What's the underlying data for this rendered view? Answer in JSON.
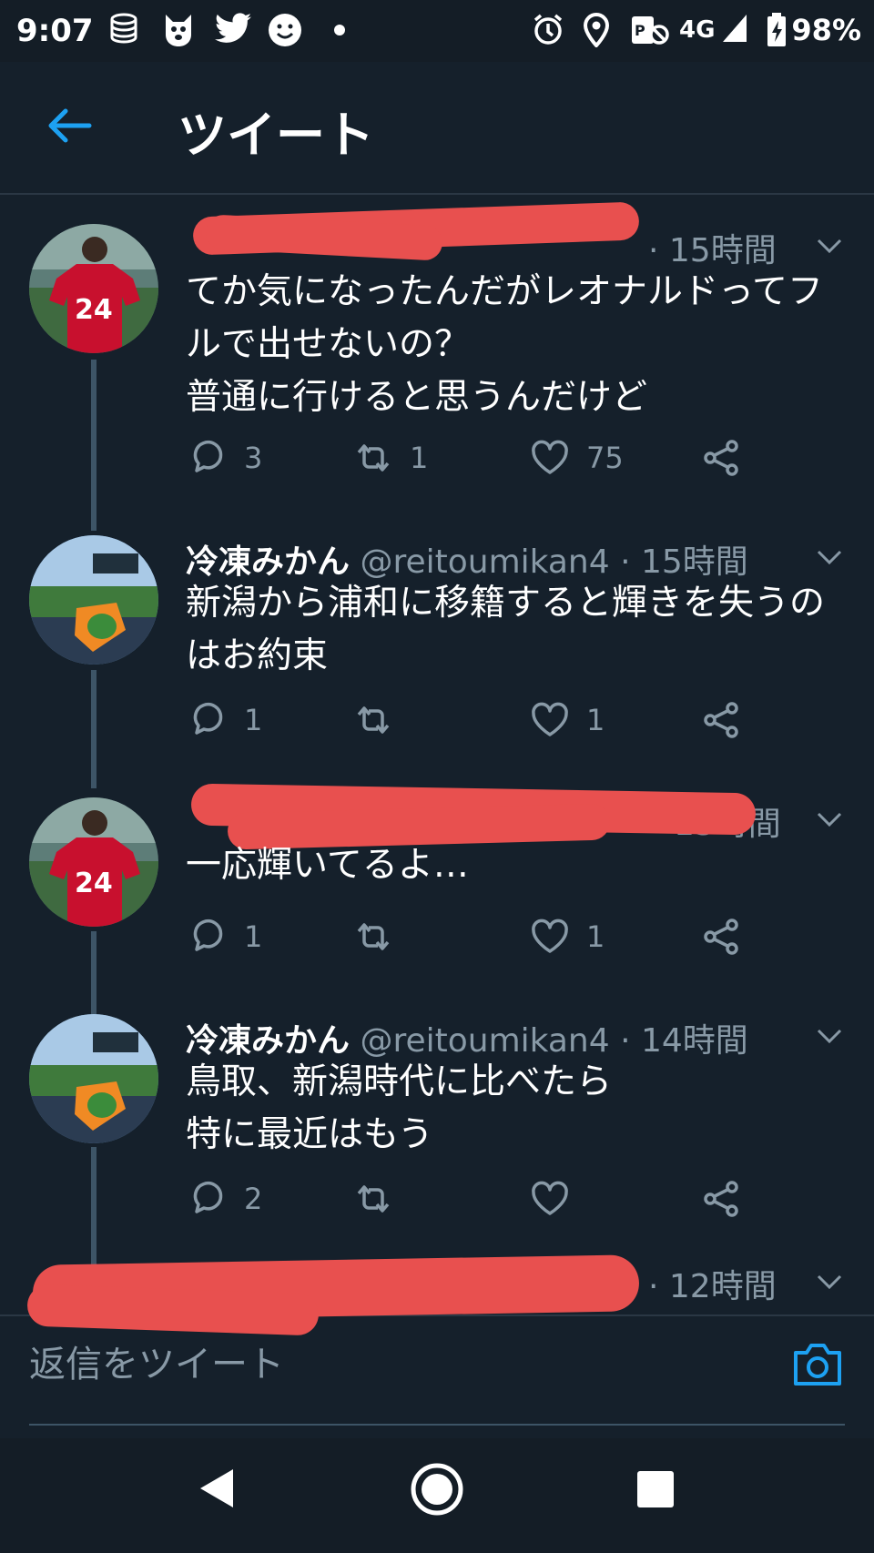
{
  "status_bar": {
    "time": "9:07",
    "network": "4G",
    "battery": "98%",
    "left_icons": [
      "database-icon",
      "dog-app-icon",
      "twitter-bird-icon",
      "smiley-icon",
      "dot-icon"
    ],
    "right_icons": [
      "alarm-icon",
      "location-icon",
      "vpn-icon",
      "signal-icon",
      "battery-icon"
    ]
  },
  "header": {
    "title": "ツイート"
  },
  "tweets": [
    {
      "name": "",
      "handle": "",
      "time": "· 15時間",
      "text": "てか気になったんだがレオナルドってフ\nルで出せないの？\n普通に行けると思うんだけど",
      "replies": "3",
      "retweets": "1",
      "likes": "75",
      "redacted": true
    },
    {
      "name": "冷凍みかん",
      "handle": "@reitoumikan4",
      "time": "· 15時間",
      "text": "新潟から浦和に移籍すると輝きを失うの\nはお約束",
      "replies": "1",
      "retweets": "",
      "likes": "1",
      "redacted": false
    },
    {
      "name": "",
      "handle": "",
      "time": "15時間",
      "text": "一応輝いてるよ…",
      "replies": "1",
      "retweets": "",
      "likes": "1",
      "redacted": true
    },
    {
      "name": "冷凍みかん",
      "handle": "@reitoumikan4",
      "time": "· 14時間",
      "text": "鳥取、新潟時代に比べたら\n特に最近はもう",
      "replies": "2",
      "retweets": "",
      "likes": "",
      "redacted": false
    },
    {
      "name": "",
      "handle": "",
      "time": "· 12時間",
      "redacted": true
    }
  ],
  "reply_bar": {
    "placeholder": "返信をツイート"
  },
  "colors": {
    "background": "#15202b",
    "accent": "#1da1f2",
    "secondary_text": "#8899a6",
    "redaction": "#e8504f"
  }
}
